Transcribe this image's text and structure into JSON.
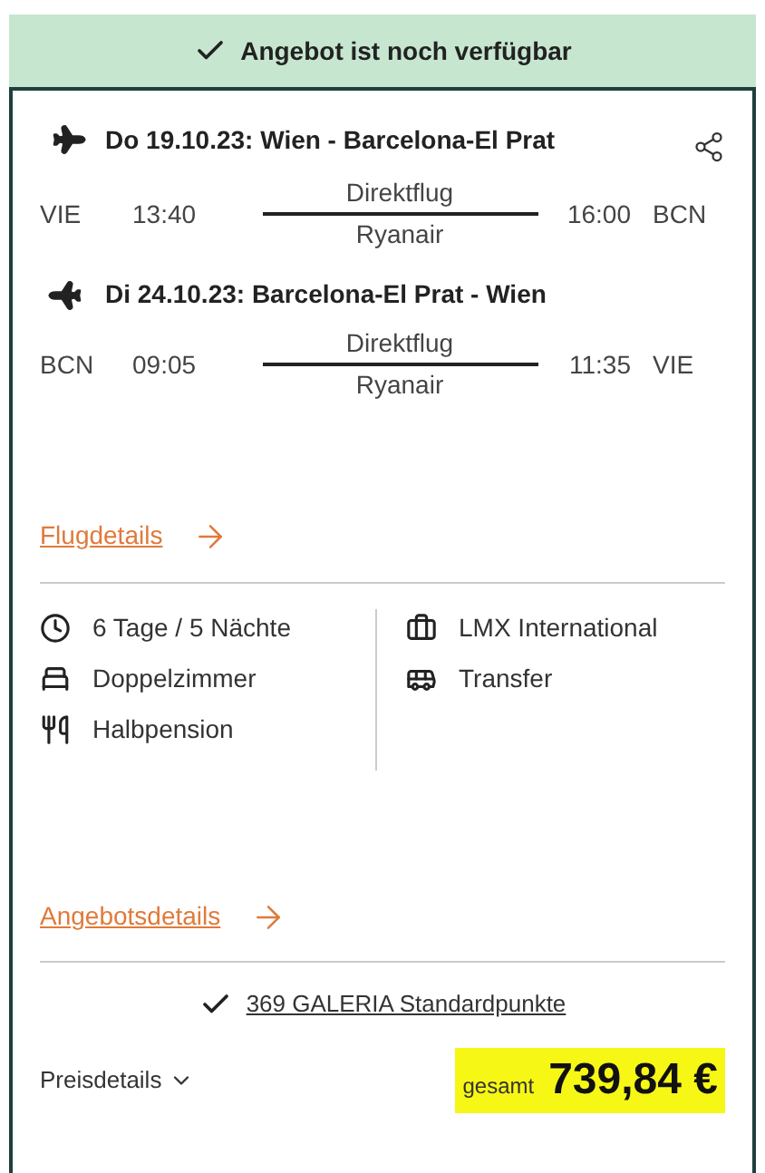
{
  "banner": {
    "text": "Angebot ist noch verfügbar"
  },
  "flights": [
    {
      "kind": "outbound",
      "title": "Do 19.10.23: Wien - Barcelona-El Prat",
      "from": "VIE",
      "dep": "13:40",
      "type": "Direktflug",
      "airline": "Ryanair",
      "arr": "16:00",
      "to": "BCN"
    },
    {
      "kind": "return",
      "title": "Di 24.10.23: Barcelona-El Prat - Wien",
      "from": "BCN",
      "dep": "09:05",
      "type": "Direktflug",
      "airline": "Ryanair",
      "arr": "11:35",
      "to": "VIE"
    }
  ],
  "flight_details_link": "Flugdetails",
  "features_left": [
    {
      "kind": "duration",
      "text": "6 Tage / 5 Nächte"
    },
    {
      "kind": "room",
      "text": "Doppelzimmer"
    },
    {
      "kind": "board",
      "text": "Halbpension"
    }
  ],
  "features_right": [
    {
      "kind": "operator",
      "text": "LMX International"
    },
    {
      "kind": "transfer",
      "text": "Transfer"
    }
  ],
  "offer_details_link": "Angebotsdetails",
  "points": "369 GALERIA Standardpunkte",
  "price_details": "Preisdetails",
  "price": {
    "label": "gesamt",
    "amount": "739,84 €"
  }
}
